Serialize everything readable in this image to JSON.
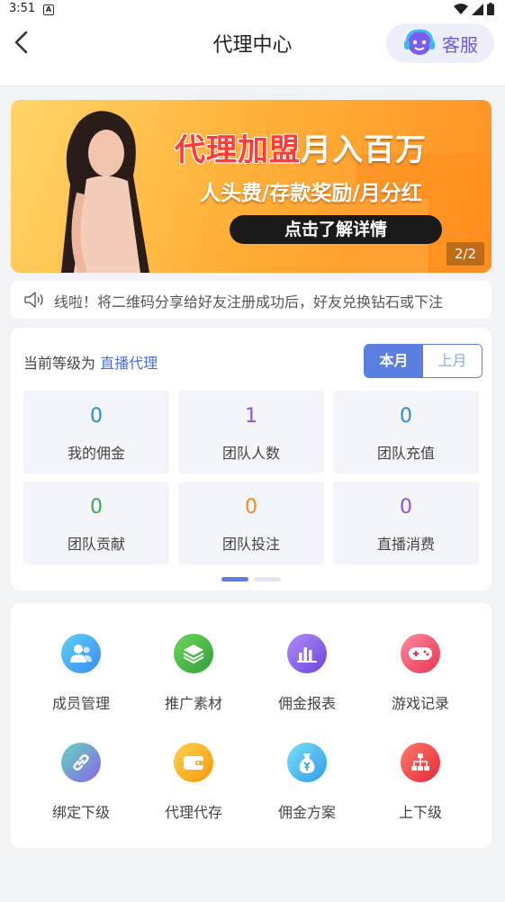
{
  "status_bar": {
    "time": "3:51",
    "notif_glyph": "A"
  },
  "header": {
    "title": "代理中心",
    "customer_service_label": "客服"
  },
  "banner": {
    "headline_part1": "代理加盟",
    "headline_part2": "月入百万",
    "subline": "人头费/存款奖励/月分红",
    "cta": "点击了解详情",
    "pager": "2/2"
  },
  "notice": {
    "text": "线啦！将二维码分享给好友注册成功后，好友兑换钻石或下注"
  },
  "stats": {
    "level_prefix": "当前等级为",
    "level_value": "直播代理",
    "tab_this_month": "本月",
    "tab_last_month": "上月",
    "cells": [
      {
        "value": "0",
        "label": "我的佣金",
        "color": "#2a8ad8"
      },
      {
        "value": "1",
        "label": "团队人数",
        "color": "#8a56d8"
      },
      {
        "value": "0",
        "label": "团队充值",
        "color": "#2a8ad8"
      },
      {
        "value": "0",
        "label": "团队贡献",
        "color": "#3ea84a"
      },
      {
        "value": "0",
        "label": "团队投注",
        "color": "#f08a1c"
      },
      {
        "value": "0",
        "label": "直播消费",
        "color": "#8a56d8"
      }
    ]
  },
  "menu": {
    "items": [
      {
        "label": "成员管理",
        "icon": "members-icon",
        "color": "#3fa8f0"
      },
      {
        "label": "推广素材",
        "icon": "layers-icon",
        "color": "#46b83f"
      },
      {
        "label": "佣金报表",
        "icon": "bar-chart-icon",
        "color": "#8a63e6"
      },
      {
        "label": "游戏记录",
        "icon": "gamepad-icon",
        "color": "#f0506a"
      },
      {
        "label": "绑定下级",
        "icon": "link-icon",
        "color": "#3fc0b8"
      },
      {
        "label": "代理代存",
        "icon": "wallet-icon",
        "color": "#f6a81c"
      },
      {
        "label": "佣金方案",
        "icon": "money-bag-icon",
        "color": "#3fa8f0"
      },
      {
        "label": "上下级",
        "icon": "hierarchy-icon",
        "color": "#f04848"
      }
    ]
  },
  "colors": {
    "accent": "#5b7fe0",
    "brand_purple": "#6b5be6",
    "page_bg": "#f1f3f7"
  }
}
